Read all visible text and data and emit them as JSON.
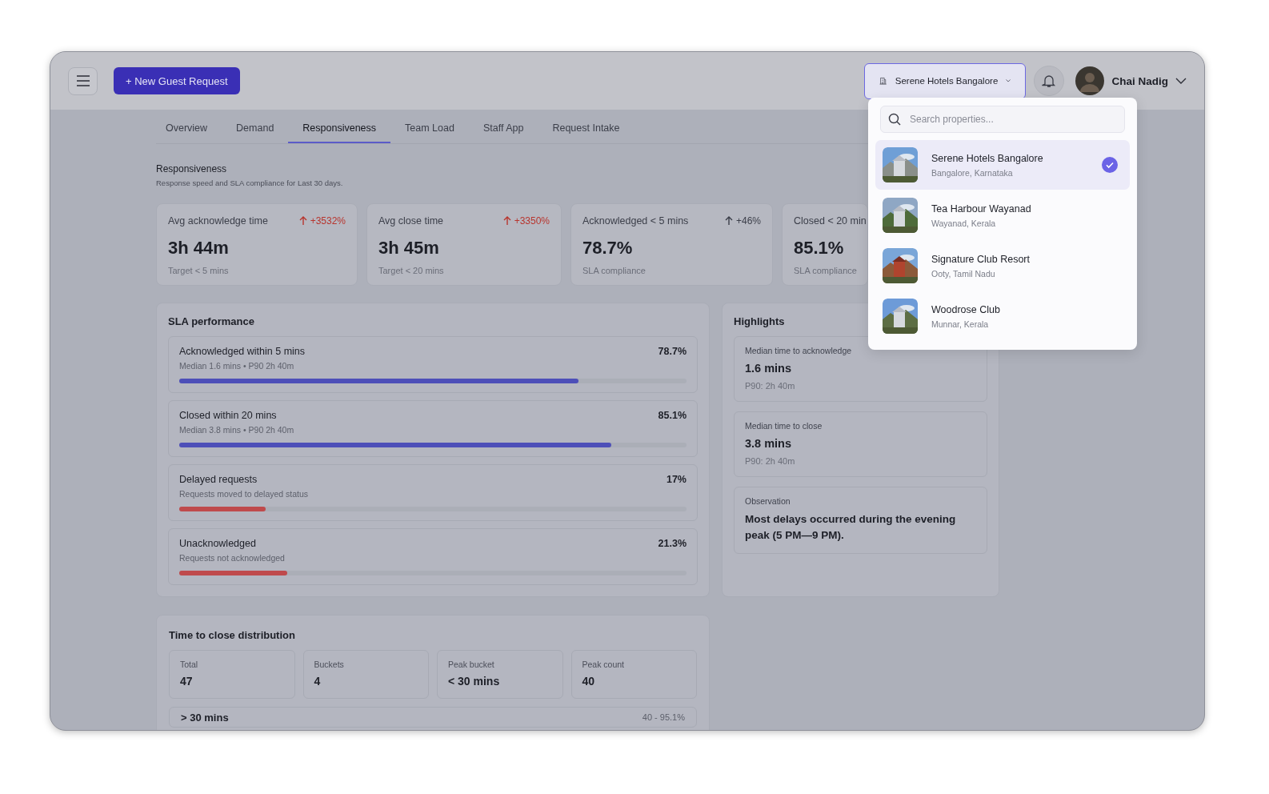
{
  "header": {
    "new_button": "+ New Guest Request",
    "property": {
      "name": "Serene Hotels Bangalore",
      "open": true
    },
    "user": {
      "name": "Chai Nadig"
    }
  },
  "tabs": [
    {
      "label": "Overview",
      "selected": false
    },
    {
      "label": "Demand",
      "selected": false
    },
    {
      "label": "Responsiveness",
      "selected": true
    },
    {
      "label": "Team Load",
      "selected": false
    },
    {
      "label": "Staff App",
      "selected": false
    },
    {
      "label": "Request Intake",
      "selected": false
    }
  ],
  "section": {
    "title": "Responsiveness",
    "subtitle": "Response speed and SLA compliance for Last 30 days."
  },
  "kpis": [
    {
      "label": "Avg acknowledge time",
      "trend": "+3532%",
      "color": "#b8352e",
      "value": "3h 44m",
      "caption": "Target < 5 mins"
    },
    {
      "label": "Avg close time",
      "trend": "+3350%",
      "color": "#b8352e",
      "value": "3h 45m",
      "caption": "Target < 20 mins"
    },
    {
      "label": "Acknowledged < 5 mins",
      "trend": "+46%",
      "color": "#3b3e49",
      "value": "78.7%",
      "caption": "SLA compliance"
    },
    {
      "label": "Closed < 20 min",
      "value": "85.1%",
      "caption": "SLA compliance"
    }
  ],
  "sla": {
    "title": "SLA performance",
    "rows": [
      {
        "label": "Acknowledged within 5 mins",
        "detail": "Median 1.6 mins • P90 2h 40m",
        "value": "78.7%",
        "level": 0.787,
        "color": "#4d4fb8"
      },
      {
        "label": "Closed within 20 mins",
        "detail": "Median 3.8 mins • P90 2h 40m",
        "value": "85.1%",
        "level": 0.851,
        "color": "#4d4fb8"
      },
      {
        "label": "Delayed requests",
        "detail": "Requests moved to delayed status",
        "value": "17%",
        "level": 0.17,
        "color": "#bf4a4c"
      },
      {
        "label": "Unacknowledged",
        "detail": "Requests not acknowledged",
        "value": "21.3%",
        "level": 0.213,
        "color": "#bf4a4c"
      }
    ]
  },
  "highlights": {
    "title": "Highlights",
    "items": [
      {
        "kind": "metric",
        "label": "Median time to acknowledge",
        "value": "1.6 mins",
        "detail": "P90: 2h 40m"
      },
      {
        "kind": "metric",
        "label": "Median time to close",
        "value": "3.8 mins",
        "detail": "P90: 2h 40m"
      },
      {
        "kind": "note",
        "label": "Observation",
        "value": "Most delays occurred during the evening peak (5 PM—9 PM)."
      }
    ]
  },
  "distribution": {
    "title": "Time to close distribution",
    "stats": [
      {
        "label": "Total",
        "value": "47"
      },
      {
        "label": "Buckets",
        "value": "4"
      },
      {
        "label": "Peak bucket",
        "value": "< 30 mins"
      },
      {
        "label": "Peak count",
        "value": "40"
      }
    ],
    "buckets": [
      {
        "label": "> 30 mins",
        "value": "40 - 95.1%"
      }
    ]
  },
  "property_menu": {
    "placeholder": "Search properties...",
    "properties": [
      {
        "name": "Serene Hotels Bangalore",
        "location": "Bangalore, Karnataka",
        "selected": true
      },
      {
        "name": "Tea Harbour Wayanad",
        "location": "Wayanad, Kerala",
        "selected": false
      },
      {
        "name": "Signature Club Resort",
        "location": "Ooty, Tamil Nadu",
        "selected": false
      },
      {
        "name": "Woodrose Club",
        "location": "Munnar, Kerala",
        "selected": false
      }
    ]
  }
}
